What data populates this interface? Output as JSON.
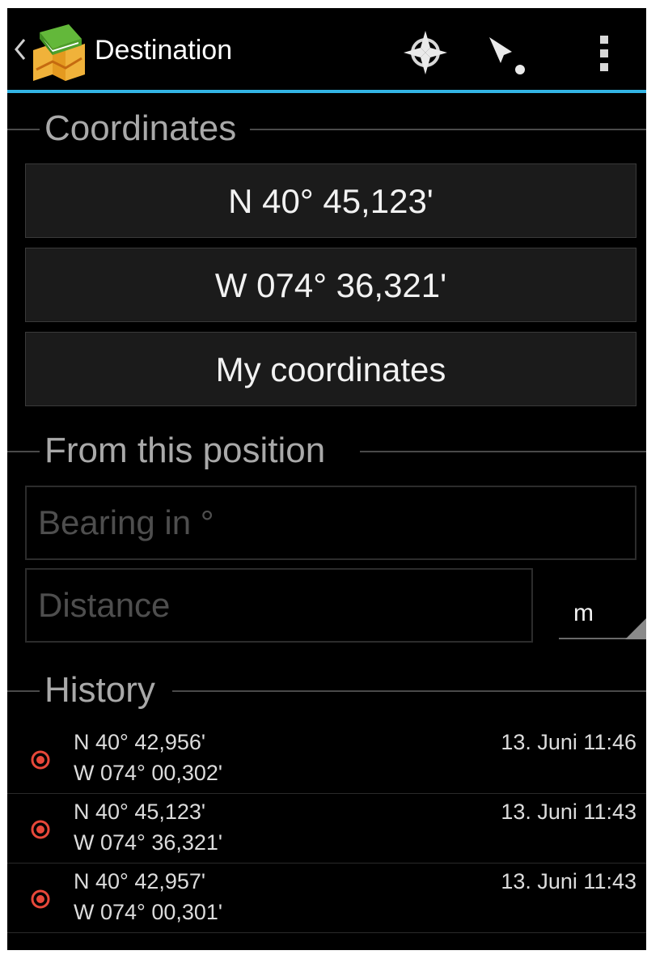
{
  "action_bar": {
    "title": "Destination",
    "icons": [
      "up-caret-icon",
      "app-map-icon",
      "compass-target-icon",
      "navigate-icon",
      "overflow-menu-icon"
    ],
    "accent_color": "#33b5e5"
  },
  "coordinates": {
    "header": "Coordinates",
    "latitude_button": "N 40° 45,123'",
    "longitude_button": "W 074° 36,321'",
    "my_coordinates_button": "My coordinates"
  },
  "from_position": {
    "header": "From this position",
    "bearing_placeholder": "Bearing in °",
    "distance_placeholder": "Distance",
    "unit": "m"
  },
  "history": {
    "header": "History",
    "items": [
      {
        "lat": "N 40° 42,956'",
        "lon": "W 074° 00,302'",
        "time": "13. Juni 11:46"
      },
      {
        "lat": "N 40° 45,123'",
        "lon": "W 074° 36,321'",
        "time": "13. Juni 11:43"
      },
      {
        "lat": "N 40° 42,957'",
        "lon": "W 074° 00,301'",
        "time": "13. Juni 11:43"
      }
    ],
    "marker_color": "#e8483a"
  }
}
